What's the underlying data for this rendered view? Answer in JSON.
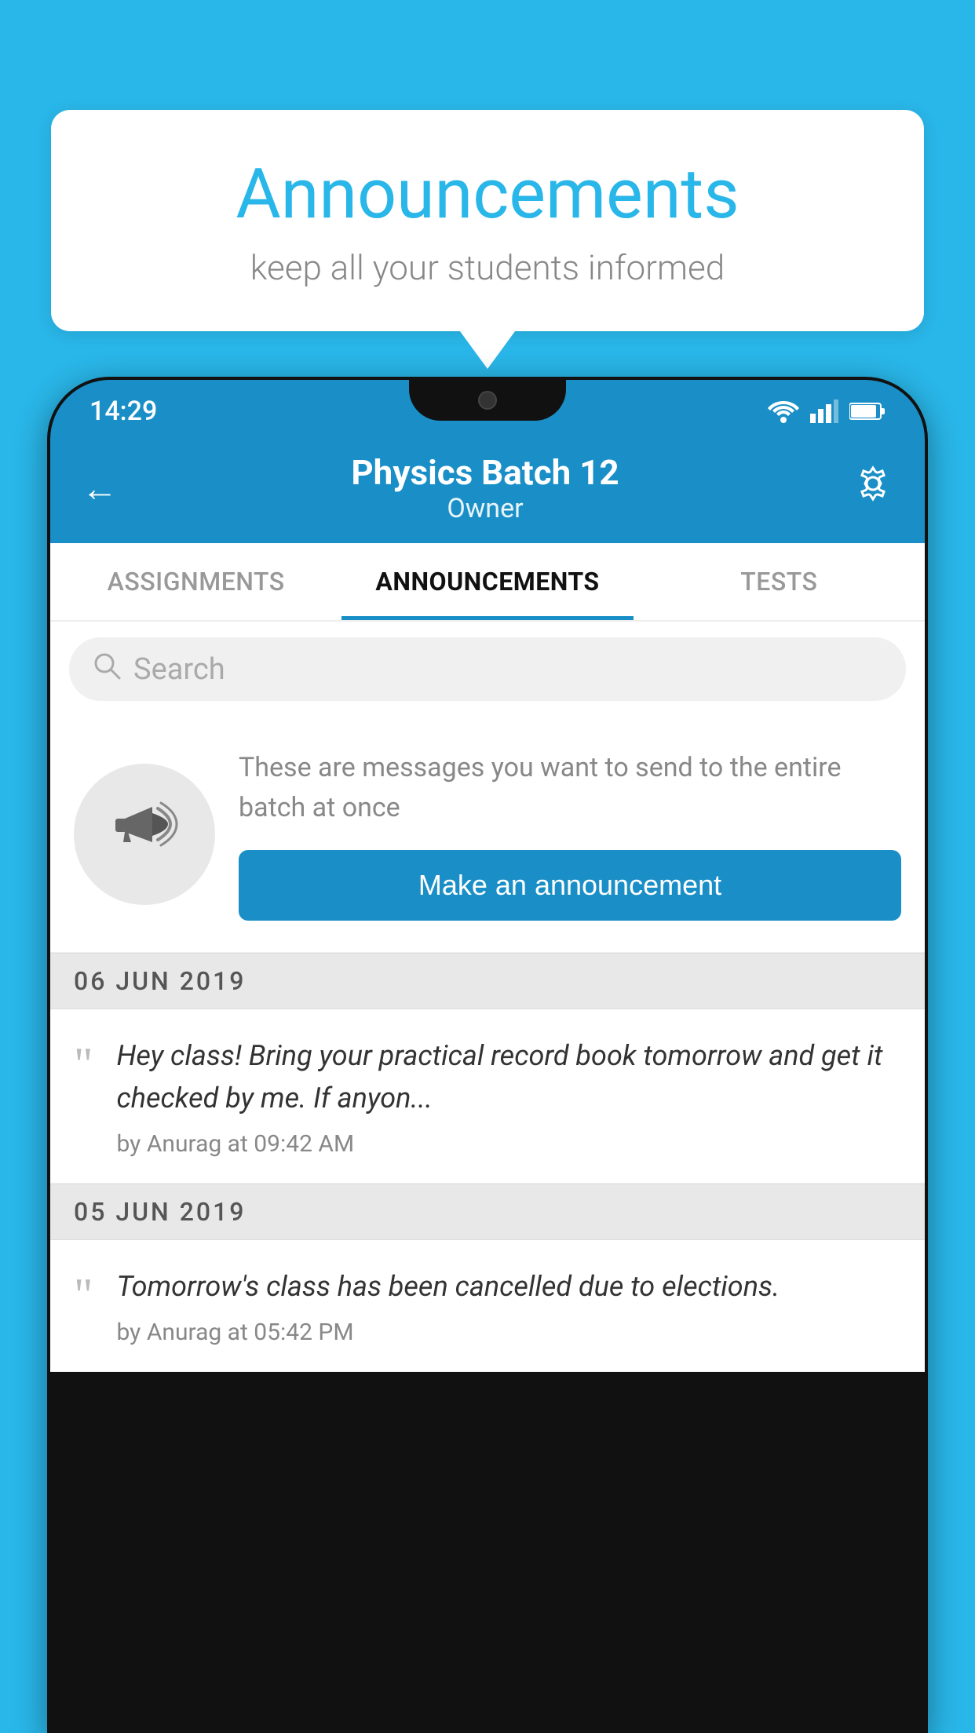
{
  "background_color": "#29b6e8",
  "speech_bubble": {
    "title": "Announcements",
    "subtitle": "keep all your students informed"
  },
  "phone": {
    "status_bar": {
      "time": "14:29",
      "icons": [
        "wifi",
        "signal",
        "battery"
      ]
    },
    "header": {
      "title": "Physics Batch 12",
      "subtitle": "Owner",
      "back_label": "←",
      "settings_label": "⚙"
    },
    "tabs": [
      {
        "label": "ASSIGNMENTS",
        "active": false
      },
      {
        "label": "ANNOUNCEMENTS",
        "active": true
      },
      {
        "label": "TESTS",
        "active": false
      },
      {
        "label": "...",
        "active": false
      }
    ],
    "search": {
      "placeholder": "Search"
    },
    "promo": {
      "description": "These are messages you want to send to the entire batch at once",
      "button_label": "Make an announcement"
    },
    "announcements": [
      {
        "date": "06  JUN  2019",
        "text": "Hey class! Bring your practical record book tomorrow and get it checked by me. If anyon...",
        "meta": "by Anurag at 09:42 AM"
      },
      {
        "date": "05  JUN  2019",
        "text": "Tomorrow's class has been cancelled due to elections.",
        "meta": "by Anurag at 05:42 PM"
      }
    ]
  }
}
